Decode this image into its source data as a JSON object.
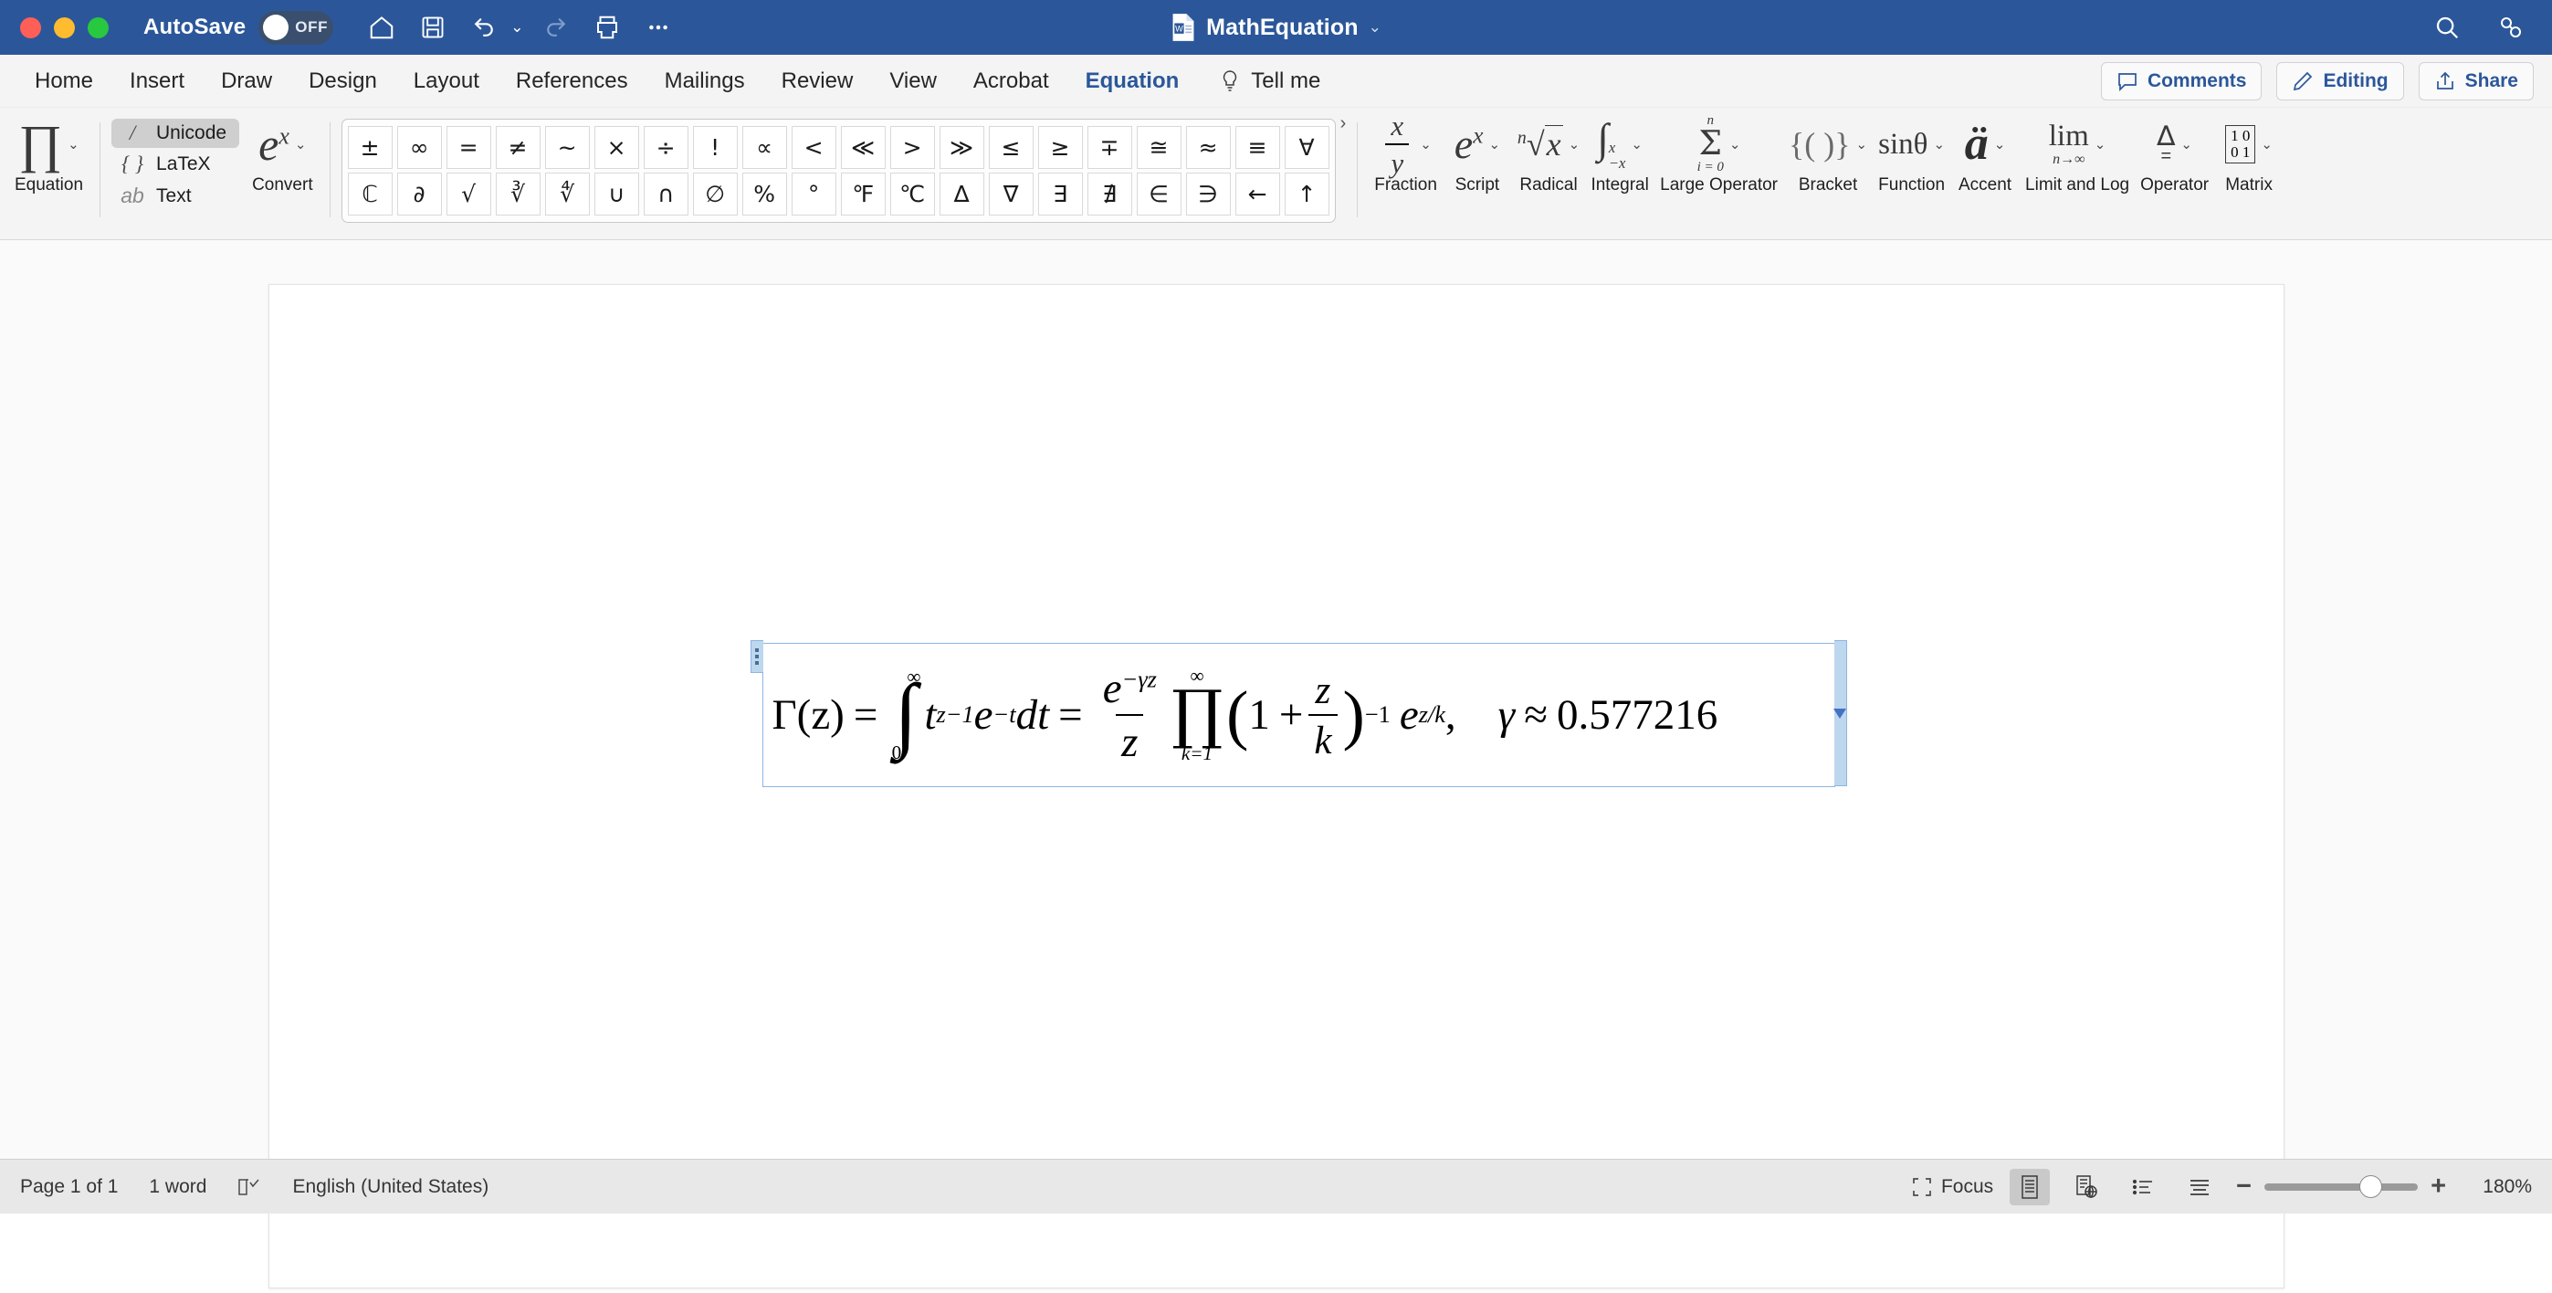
{
  "titlebar": {
    "autosave_label": "AutoSave",
    "autosave_state": "OFF",
    "document_title": "MathEquation",
    "quick_access": [
      "home-icon",
      "save-icon",
      "undo-icon",
      "undo-dropdown-icon",
      "redo-icon",
      "print-icon",
      "more-icon"
    ],
    "right_icons": [
      "search-icon",
      "format-icon"
    ],
    "bar_color": "#2b579a"
  },
  "tabs": [
    {
      "label": "Home",
      "active": false
    },
    {
      "label": "Insert",
      "active": false
    },
    {
      "label": "Draw",
      "active": false
    },
    {
      "label": "Design",
      "active": false
    },
    {
      "label": "Layout",
      "active": false
    },
    {
      "label": "References",
      "active": false
    },
    {
      "label": "Mailings",
      "active": false
    },
    {
      "label": "Review",
      "active": false
    },
    {
      "label": "View",
      "active": false
    },
    {
      "label": "Acrobat",
      "active": false
    },
    {
      "label": "Equation",
      "active": true
    }
  ],
  "tell_me": {
    "label": "Tell me",
    "icon": "lightbulb-icon"
  },
  "tab_actions": [
    {
      "label": "Comments",
      "icon": "comment-icon"
    },
    {
      "label": "Editing",
      "icon": "pencil-icon"
    },
    {
      "label": "Share",
      "icon": "share-icon"
    }
  ],
  "ribbon": {
    "tools_group": {
      "equation": {
        "label": "Equation",
        "glyph": "∏",
        "icon": "pi-product-icon"
      },
      "modes": [
        {
          "label": "Unicode",
          "icon": "slash-icon",
          "glyph": "/",
          "selected": true
        },
        {
          "label": "LaTeX",
          "icon": "braces-icon",
          "glyph": "{ }",
          "selected": false
        },
        {
          "label": "Text",
          "icon": "ab-icon",
          "glyph": "ab",
          "selected": false
        }
      ],
      "convert": {
        "label": "Convert",
        "icon": "exponential-icon"
      }
    },
    "symbols": {
      "row1": [
        "±",
        "∞",
        "=",
        "≠",
        "~",
        "×",
        "÷",
        "!",
        "∝",
        "<",
        "≪",
        ">",
        "≫",
        "≤",
        "≥",
        "∓",
        "≅",
        "≈",
        "≡",
        "∀"
      ],
      "row2": [
        "ℂ",
        "∂",
        "√",
        "∛",
        "∜",
        "∪",
        "∩",
        "∅",
        "%",
        "°",
        "℉",
        "℃",
        "∆",
        "∇",
        "∃",
        "∄",
        "∈",
        "∋",
        "←",
        "↑"
      ],
      "more": "›"
    },
    "structures": [
      {
        "label": "Fraction",
        "icon": "fraction-icon"
      },
      {
        "label": "Script",
        "icon": "script-icon"
      },
      {
        "label": "Radical",
        "icon": "radical-icon"
      },
      {
        "label": "Integral",
        "icon": "integral-icon"
      },
      {
        "label": "Large Operator",
        "icon": "sigma-icon"
      },
      {
        "label": "Bracket",
        "icon": "bracket-icon"
      },
      {
        "label": "Function",
        "icon": "function-icon"
      },
      {
        "label": "Accent",
        "icon": "accent-icon"
      },
      {
        "label": "Limit and Log",
        "icon": "limit-icon"
      },
      {
        "label": "Operator",
        "icon": "operator-icon"
      },
      {
        "label": "Matrix",
        "icon": "matrix-icon"
      }
    ]
  },
  "document": {
    "equation": {
      "gamma_fn": "Γ(z)",
      "eq1": "=",
      "integral_lower": "0",
      "integral_upper": "∞",
      "integrand_t": "t",
      "integrand_t_exp": "z−1",
      "integrand_e": "e",
      "integrand_e_exp": "−t",
      "differential": "dt",
      "eq2": "=",
      "frac_num_e": "e",
      "frac_num_exp": "−γz",
      "frac_den": "z",
      "prod_upper": "∞",
      "prod_symbol": "∏",
      "prod_lower": "k=1",
      "paren_open": "(",
      "one": "1",
      "plus": "+",
      "inner_num": "z",
      "inner_den": "k",
      "paren_close": ")",
      "paren_exp": "−1",
      "tail_e": "e",
      "tail_exp": "z/k",
      "comma": ",",
      "gamma_const": "γ",
      "approx": "≈",
      "gamma_value": "0.577216"
    },
    "selection_color": "#8eb4e3",
    "handle_color": "#bdd7ee"
  },
  "statusbar": {
    "page_info": "Page 1 of 1",
    "word_count": "1 word",
    "proofing_icon": "proofing-icon",
    "language": "English (United States)",
    "focus_label": "Focus",
    "view_modes": [
      "print-layout-icon",
      "web-layout-icon",
      "outline-icon",
      "draft-icon"
    ],
    "zoom_minus": "−",
    "zoom_plus": "+",
    "zoom_value": "180%"
  }
}
